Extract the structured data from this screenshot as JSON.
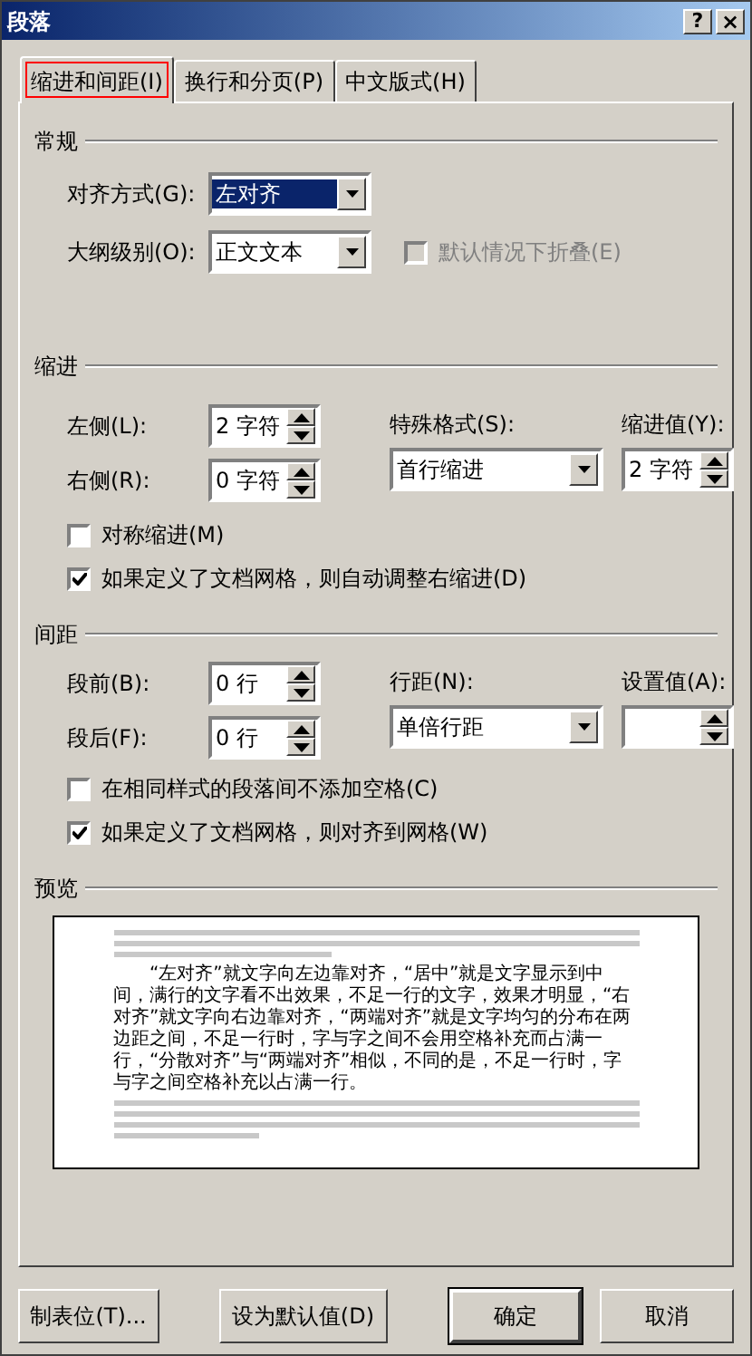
{
  "window": {
    "title": "段落",
    "help_button": "?",
    "close_button": "×"
  },
  "tabs": [
    {
      "label": "缩进和间距(I)",
      "selected": true,
      "highlighted": true
    },
    {
      "label": "换行和分页(P)",
      "selected": false,
      "highlighted": false
    },
    {
      "label": "中文版式(H)",
      "selected": false,
      "highlighted": false
    }
  ],
  "general": {
    "title": "常规",
    "alignment": {
      "label": "对齐方式(G):",
      "value": "左对齐",
      "focused": true
    },
    "outline_level": {
      "label": "大纲级别(O):",
      "value": "正文文本",
      "focused": false
    },
    "collapse": {
      "label": "默认情况下折叠(E)",
      "checked": false,
      "disabled": true
    }
  },
  "indent": {
    "title": "缩进",
    "left": {
      "label": "左侧(L):",
      "value": "2 字符"
    },
    "right": {
      "label": "右侧(R):",
      "value": "0 字符"
    },
    "special": {
      "label": "特殊格式(S):",
      "value": "首行缩进",
      "focused": false
    },
    "by": {
      "label": "缩进值(Y):",
      "value": "2 字符"
    },
    "checkboxes": [
      {
        "label": "对称缩进(M)",
        "checked": false,
        "disabled": false
      },
      {
        "label": "如果定义了文档网格，则自动调整右缩进(D)",
        "checked": true,
        "disabled": false
      }
    ]
  },
  "spacing": {
    "title": "间距",
    "before": {
      "label": "段前(B):",
      "value": "0 行"
    },
    "after": {
      "label": "段后(F):",
      "value": "0 行"
    },
    "line_spacing": {
      "label": "行距(N):",
      "value": "单倍行距",
      "focused": false
    },
    "at": {
      "label": "设置值(A):"
    },
    "checkboxes": [
      {
        "label": "在相同样式的段落间不添加空格(C)",
        "checked": false,
        "disabled": false
      },
      {
        "label": "如果定义了文档网格，则对齐到网格(W)",
        "checked": true,
        "disabled": false
      }
    ]
  },
  "preview": {
    "title": "预览",
    "sample_text": "“左对齐”就文字向左边靠对齐，“居中”就是文字显示到中间，满行的文字看不出效果，不足一行的文字，效果才明显，“右对齐”就文字向右边靠对齐，“两端对齐”就是文字均匀的分布在两边距之间，不足一行时，字与字之间不会用空格补充而占满一行，“分散对齐”与“两端对齐”相似，不同的是，不足一行时，字与字之间空格补充以占满一行。"
  },
  "buttons": [
    {
      "label": "制表位(T)...",
      "default": false
    },
    {
      "label": "设为默认值(D)",
      "default": false
    },
    {
      "label": "确定",
      "default": true
    },
    {
      "label": "取消",
      "default": false
    }
  ]
}
